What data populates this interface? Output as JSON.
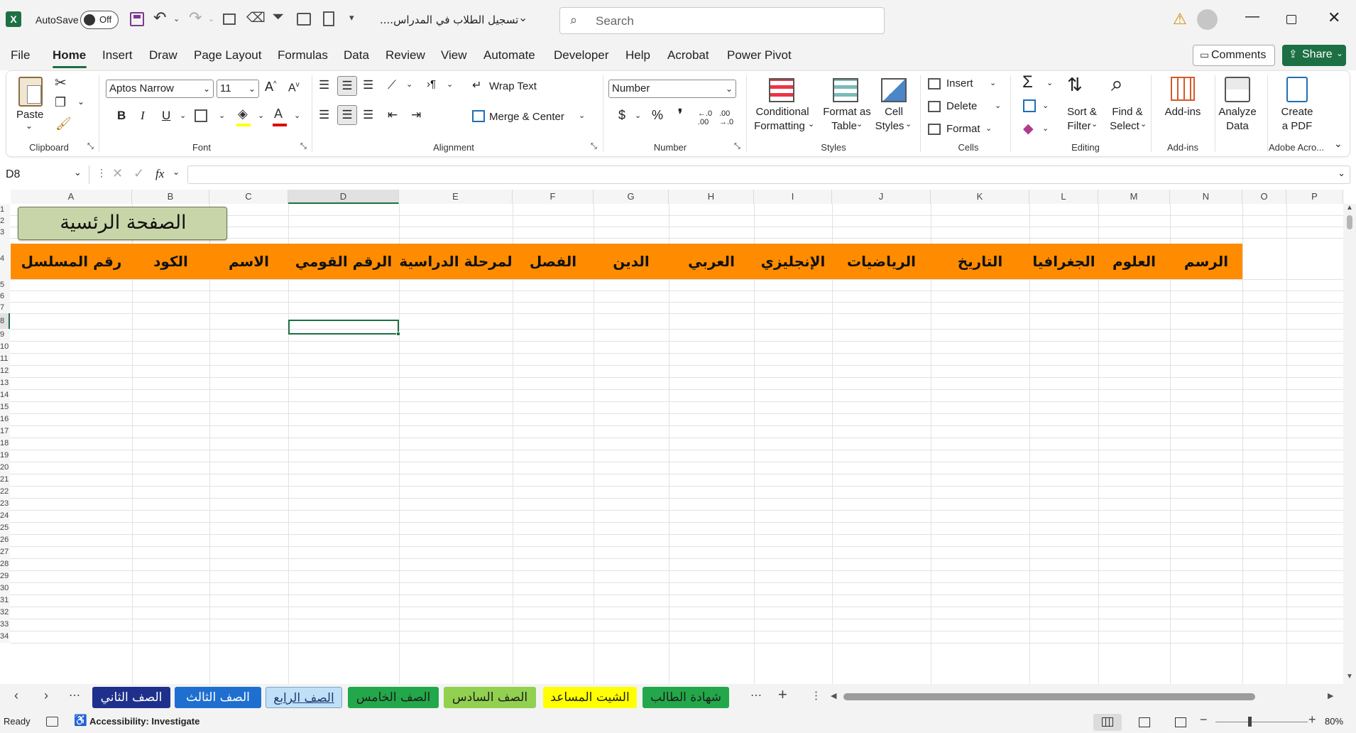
{
  "titlebar": {
    "autosave_label": "AutoSave",
    "autosave_state": "Off",
    "file_name": "تسجيل الطلاب في المدراس....",
    "search_placeholder": "Search"
  },
  "menu": {
    "tabs": [
      "File",
      "Home",
      "Insert",
      "Draw",
      "Page Layout",
      "Formulas",
      "Data",
      "Review",
      "View",
      "Automate",
      "Developer",
      "Help",
      "Acrobat",
      "Power Pivot"
    ],
    "active": "Home",
    "comments_label": "Comments",
    "share_label": "Share"
  },
  "ribbon": {
    "clipboard": {
      "paste": "Paste",
      "group": "Clipboard"
    },
    "font": {
      "name": "Aptos Narrow",
      "size": "11",
      "group": "Font"
    },
    "alignment": {
      "wrap": "Wrap Text",
      "merge": "Merge & Center",
      "group": "Alignment"
    },
    "number": {
      "format": "Number",
      "group": "Number"
    },
    "styles": {
      "conditional_1": "Conditional",
      "conditional_2": "Formatting",
      "format_table_1": "Format as",
      "format_table_2": "Table",
      "cell_styles_1": "Cell",
      "cell_styles_2": "Styles",
      "group": "Styles"
    },
    "cells": {
      "insert": "Insert",
      "delete": "Delete",
      "format": "Format",
      "group": "Cells"
    },
    "editing": {
      "sort_1": "Sort &",
      "sort_2": "Filter",
      "find_1": "Find &",
      "find_2": "Select",
      "group": "Editing"
    },
    "addins": {
      "label": "Add-ins",
      "group": "Add-ins"
    },
    "analyze": {
      "label_1": "Analyze",
      "label_2": "Data"
    },
    "acrobat": {
      "label_1": "Create",
      "label_2": "a PDF",
      "group": "Adobe Acro..."
    }
  },
  "formula_bar": {
    "name_box": "D8",
    "fx": "fx",
    "content": ""
  },
  "grid": {
    "columns": [
      "A",
      "B",
      "C",
      "D",
      "E",
      "F",
      "G",
      "H",
      "I",
      "J",
      "K",
      "L",
      "M",
      "N",
      "O",
      "P"
    ],
    "rows": [
      "1",
      "2",
      "3",
      "4",
      "5",
      "6",
      "7",
      "8",
      "9",
      "10",
      "11",
      "12",
      "13",
      "14",
      "15",
      "16",
      "17",
      "18",
      "19",
      "20",
      "21",
      "22",
      "23",
      "24",
      "25",
      "26",
      "27",
      "28",
      "29",
      "30",
      "31",
      "32",
      "33",
      "34"
    ],
    "home_button": "الصفحة الرئسية",
    "headers": [
      "رقم المسلسل",
      "الكود",
      "الاسم",
      "الرقم القومي",
      "لمرحلة الدراسية",
      "الفصل",
      "الدين",
      "العربي",
      "الإنجليزي",
      "الرياضيات",
      "التاريخ",
      "الجغرافيا",
      "العلوم",
      "الرسم"
    ],
    "header_color": "#ff8c00",
    "selected_cell": "D8"
  },
  "sheet_tabs": [
    {
      "label": "الصف الثاني",
      "color": "#1f2f8c",
      "text_color": "#ffffff"
    },
    {
      "label": "الصف الثالث",
      "color": "#1f6fd0",
      "text_color": "#ffffff"
    },
    {
      "label": "الصف الرابع",
      "color": "#bfe0f7",
      "text_color": "#1f3a70",
      "active": true
    },
    {
      "label": "الصف الخامس",
      "color": "#22a84a",
      "text_color": "#1d1d1d"
    },
    {
      "label": "الصف السادس",
      "color": "#92d050",
      "text_color": "#1d1d1d"
    },
    {
      "label": "الشيت المساعد",
      "color": "#ffff00",
      "text_color": "#1d1d1d"
    },
    {
      "label": "شهادة الطالب",
      "color": "#22a84a",
      "text_color": "#1d1d1d"
    }
  ],
  "status": {
    "ready": "Ready",
    "accessibility": "Accessibility: Investigate",
    "zoom": "80%"
  }
}
